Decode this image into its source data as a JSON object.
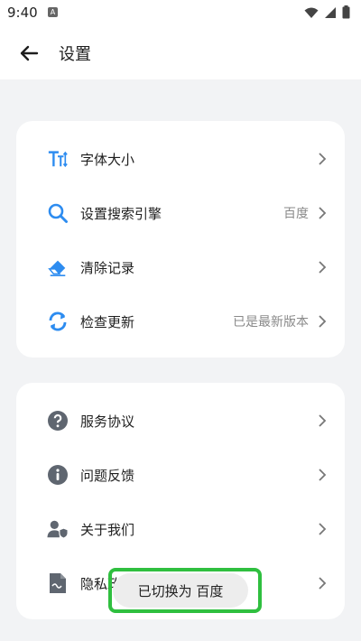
{
  "status_bar": {
    "time": "9:40",
    "notification_icon": "A"
  },
  "app_bar": {
    "title": "设置"
  },
  "group1": [
    {
      "label": "字体大小",
      "value": "",
      "icon": "font-size-icon"
    },
    {
      "label": "设置搜索引擎",
      "value": "百度",
      "icon": "search-icon"
    },
    {
      "label": "清除记录",
      "value": "",
      "icon": "eraser-icon"
    },
    {
      "label": "检查更新",
      "value": "已是最新版本",
      "icon": "refresh-icon"
    }
  ],
  "group2": [
    {
      "label": "服务协议",
      "icon": "help-icon"
    },
    {
      "label": "问题反馈",
      "icon": "info-icon"
    },
    {
      "label": "关于我们",
      "icon": "user-shield-icon"
    },
    {
      "label": "隐私政策",
      "icon": "document-icon"
    }
  ],
  "toast": {
    "text": "已切换为 百度"
  },
  "colors": {
    "accent": "#2d8cf0",
    "gray_icon": "#5f6670",
    "toast_border": "#2fbf3f"
  }
}
